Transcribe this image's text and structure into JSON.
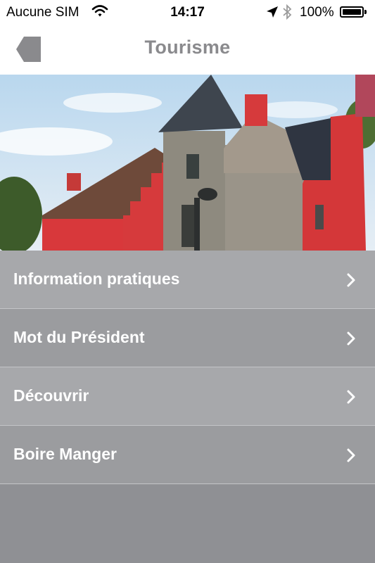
{
  "status_bar": {
    "carrier": "Aucune SIM",
    "time": "14:17",
    "battery_percent": "100%",
    "icons": [
      "wifi-icon",
      "location-arrow-icon",
      "bluetooth-icon",
      "battery-icon"
    ]
  },
  "nav": {
    "title": "Tourisme",
    "back_icon": "back-arrow-icon"
  },
  "hero": {
    "description_icon": "building-photo"
  },
  "menu": {
    "items": [
      {
        "label": "Information pratiques"
      },
      {
        "label": "Mot du Président"
      },
      {
        "label": "Découvrir"
      },
      {
        "label": "Boire Manger"
      }
    ],
    "chevron_icon": "chevron-right-icon"
  },
  "colors": {
    "menu_light": "#a7a8ab",
    "menu_dark": "#9b9c9f",
    "background": "#8f9094",
    "title_gray": "#8a8a8d"
  }
}
